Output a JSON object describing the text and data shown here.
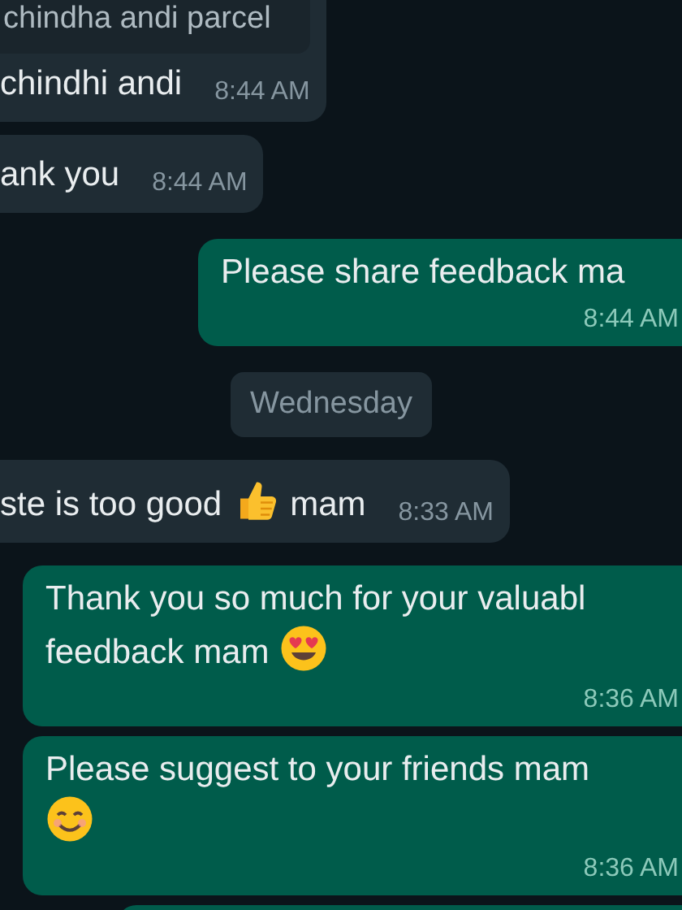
{
  "messages": [
    {
      "kind": "in",
      "quote": "chindha andi parcel",
      "parts": [
        {
          "kind": "text",
          "text": "chindhi andi"
        }
      ],
      "time": "8:44 AM"
    },
    {
      "kind": "in",
      "parts": [
        {
          "kind": "text",
          "text": "ank you"
        }
      ],
      "time": "8:44 AM"
    },
    {
      "kind": "out",
      "parts": [
        {
          "kind": "text",
          "text": "Please share feedback ma"
        }
      ],
      "time": "8:44 AM"
    },
    {
      "kind": "date",
      "text": "Wednesday"
    },
    {
      "kind": "in",
      "parts": [
        {
          "kind": "text",
          "text": "ste is too good"
        },
        {
          "kind": "thumbs_up"
        },
        {
          "kind": "text",
          "text": "mam"
        }
      ],
      "time": "8:33 AM"
    },
    {
      "kind": "out",
      "parts": [
        {
          "kind": "text",
          "text": "Thank you so much for your valuabl"
        },
        {
          "kind": "break"
        },
        {
          "kind": "text",
          "text": "feedback mam"
        },
        {
          "kind": "heart_eyes"
        }
      ],
      "time": "8:36 AM"
    },
    {
      "kind": "out",
      "parts": [
        {
          "kind": "text",
          "text": "Please suggest to your friends mam"
        },
        {
          "kind": "break"
        },
        {
          "kind": "smile"
        }
      ],
      "time": "8:36 AM"
    },
    {
      "kind": "out_stub"
    }
  ]
}
